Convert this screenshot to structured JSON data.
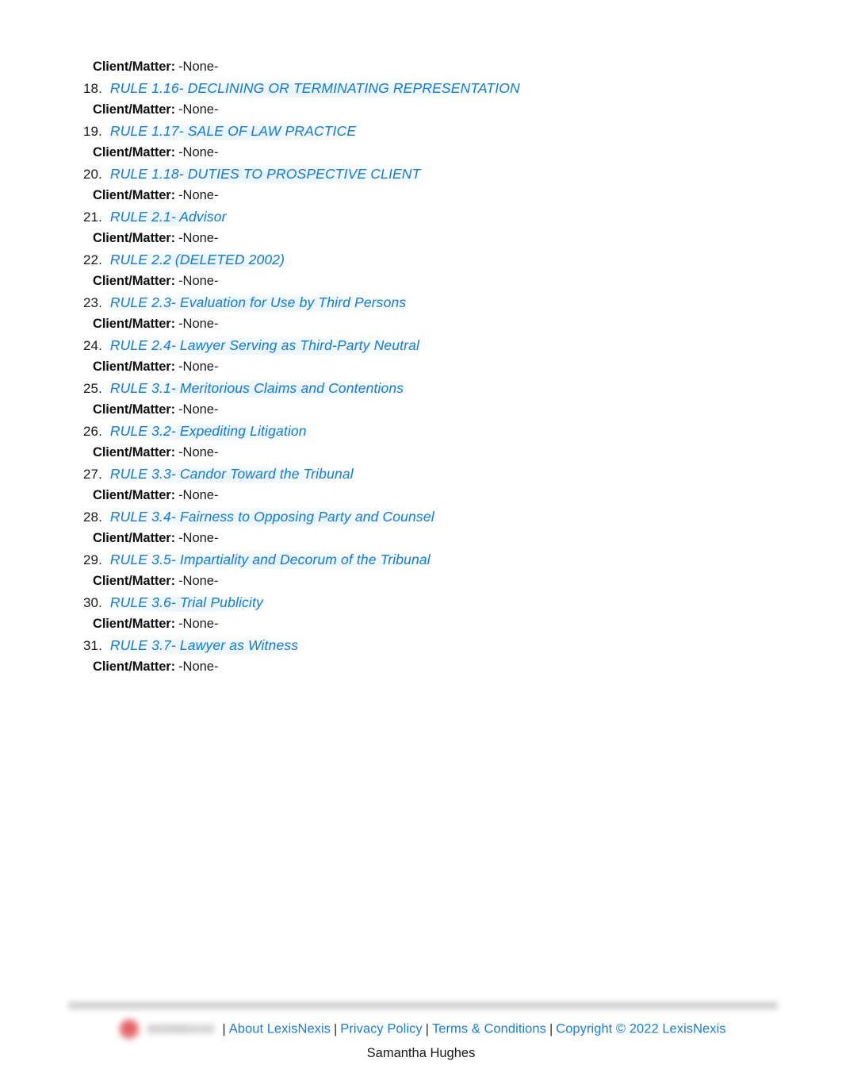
{
  "document": {
    "background_color": "#ffffff",
    "link_color": "#1b7ed2",
    "text_color": "#1a1a1a"
  },
  "rules": [
    {
      "number": "18.",
      "title": "RULE 1.16-  DECLINING OR TERMINATING REPRESENTATION",
      "client_matter_label": "Client/Matter:",
      "client_matter_value": "-None-"
    },
    {
      "number": "19.",
      "title": "RULE 1.17-  SALE OF LAW PRACTICE",
      "client_matter_label": "Client/Matter:",
      "client_matter_value": "-None-"
    },
    {
      "number": "20.",
      "title": "RULE 1.18-  DUTIES TO PROSPECTIVE CLIENT",
      "client_matter_label": "Client/Matter:",
      "client_matter_value": "-None-"
    },
    {
      "number": "21.",
      "title": "RULE 2.1-  Advisor",
      "client_matter_label": "Client/Matter:",
      "client_matter_value": "-None-"
    },
    {
      "number": "22.",
      "title": "RULE 2.2  (DELETED 2002)",
      "client_matter_label": "Client/Matter:",
      "client_matter_value": "-None-"
    },
    {
      "number": "23.",
      "title": "RULE 2.3-  Evaluation for Use by Third Persons",
      "client_matter_label": "Client/Matter:",
      "client_matter_value": "-None-"
    },
    {
      "number": "24.",
      "title": "RULE 2.4-  Lawyer Serving as Third-Party Neutral",
      "client_matter_label": "Client/Matter:",
      "client_matter_value": "-None-"
    },
    {
      "number": "25.",
      "title": "RULE 3.1-  Meritorious Claims and Contentions",
      "client_matter_label": "Client/Matter:",
      "client_matter_value": "-None-"
    },
    {
      "number": "26.",
      "title": "RULE 3.2-  Expediting Litigation",
      "client_matter_label": "Client/Matter:",
      "client_matter_value": "-None-"
    },
    {
      "number": "27.",
      "title": "RULE 3.3-  Candor Toward the Tribunal",
      "client_matter_label": "Client/Matter:",
      "client_matter_value": "-None-"
    },
    {
      "number": "28.",
      "title": "RULE 3.4-  Fairness to Opposing Party and Counsel",
      "client_matter_label": "Client/Matter:",
      "client_matter_value": "-None-"
    },
    {
      "number": "29.",
      "title": "RULE 3.5-  Impartiality and Decorum of the Tribunal",
      "client_matter_label": "Client/Matter:",
      "client_matter_value": "-None-"
    },
    {
      "number": "30.",
      "title": "RULE 3.6-  Trial Publicity",
      "client_matter_label": "Client/Matter:",
      "client_matter_value": "-None-"
    },
    {
      "number": "31.",
      "title": "RULE 3.7-  Lawyer as Witness",
      "client_matter_label": "Client/Matter:",
      "client_matter_value": "-None-"
    }
  ],
  "leading_client_matter": {
    "label": "Client/Matter:",
    "value": "-None-"
  },
  "footer": {
    "logo_name": "lexisnexis-logo",
    "separator": "|",
    "links": [
      {
        "label": "About LexisNexis"
      },
      {
        "label": "Privacy Policy"
      },
      {
        "label": "Terms & Conditions"
      }
    ],
    "copyright": "Copyright © 2022 LexisNexis",
    "user_name": "Samantha Hughes"
  }
}
